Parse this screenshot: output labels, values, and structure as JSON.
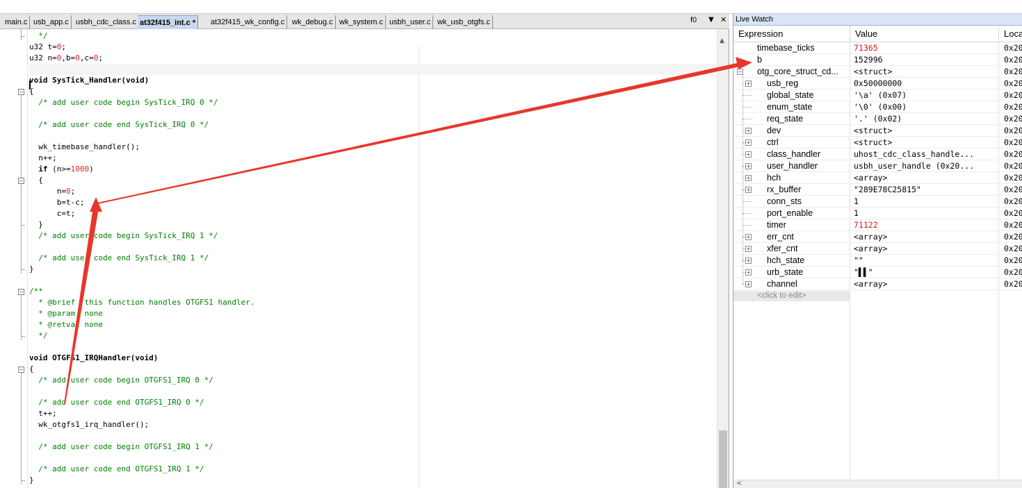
{
  "editor": {
    "tabs": [
      "main.c",
      "usb_app.c",
      "usbh_cdc_class.c",
      "at32f415_int.c *",
      "at32f415_wk_config.c",
      "wk_debug.c",
      "wk_system.c",
      "usbh_user.c",
      "wk_usb_otgfs.c"
    ],
    "active_tab": "at32f415_int.c *",
    "function_dropdown": "f0",
    "lines": [
      {
        "t": "  */",
        "c": "cm"
      },
      {
        "t": "u32 t=0;"
      },
      {
        "t": "u32 n=0,b=0,c=0;"
      },
      {
        "t": ""
      },
      {
        "t": "void SysTick_Handler(void)",
        "c": "kw"
      },
      {
        "t": "{"
      },
      {
        "t": "  /* add user code begin SysTick_IRQ 0 */",
        "c": "cm"
      },
      {
        "t": ""
      },
      {
        "t": "  /* add user code end SysTick_IRQ 0 */",
        "c": "cm"
      },
      {
        "t": ""
      },
      {
        "t": "  wk_timebase_handler();"
      },
      {
        "t": "  n++;"
      },
      {
        "t": "  if (n>=1000)"
      },
      {
        "t": "  {"
      },
      {
        "t": "      n=0;"
      },
      {
        "t": "      b=t-c;"
      },
      {
        "t": "      c=t;"
      },
      {
        "t": "  }"
      },
      {
        "t": "  /* add user code begin SysTick_IRQ 1 */",
        "c": "cm"
      },
      {
        "t": ""
      },
      {
        "t": "  /* add user code end SysTick_IRQ 1 */",
        "c": "cm"
      },
      {
        "t": "}"
      },
      {
        "t": ""
      },
      {
        "t": "/**",
        "c": "cm"
      },
      {
        "t": "  * @brief  this function handles OTGFS1 handler.",
        "c": "cm"
      },
      {
        "t": "  * @param  none",
        "c": "cm"
      },
      {
        "t": "  * @retval none",
        "c": "cm"
      },
      {
        "t": "  */",
        "c": "cm"
      },
      {
        "t": ""
      },
      {
        "t": "void OTGFS1_IRQHandler(void)",
        "c": "kw"
      },
      {
        "t": "{"
      },
      {
        "t": "  /* add user code begin OTGFS1_IRQ 0 */",
        "c": "cm"
      },
      {
        "t": ""
      },
      {
        "t": "  /* add user code end OTGFS1_IRQ 0 */",
        "c": "cm"
      },
      {
        "t": "  t++;"
      },
      {
        "t": "  wk_otgfs1_irq_handler();"
      },
      {
        "t": ""
      },
      {
        "t": "  /* add user code begin OTGFS1_IRQ 1 */",
        "c": "cm"
      },
      {
        "t": ""
      },
      {
        "t": "  /* add user code end OTGFS1_IRQ 1 */",
        "c": "cm"
      },
      {
        "t": "}"
      }
    ]
  },
  "watch": {
    "title": "Live Watch",
    "columns": [
      "Expression",
      "Value",
      "Location"
    ],
    "rows": [
      {
        "expr": "timebase_ticks",
        "value": "71365",
        "loc": "0x20",
        "red": true,
        "level": 0
      },
      {
        "expr": "b",
        "value": "152996",
        "loc": "0x20",
        "red": false,
        "level": 0
      },
      {
        "expr": "otg_core_struct_cd...",
        "value": "<struct>",
        "loc": "0x20",
        "red": false,
        "level": 0,
        "expander": "minus"
      },
      {
        "expr": "usb_reg",
        "value": "0x50000000",
        "loc": "0x20",
        "red": false,
        "level": 1,
        "expander": "plus"
      },
      {
        "expr": "global_state",
        "value": "'\\a' (0x07)",
        "loc": "0x20",
        "red": false,
        "level": 1
      },
      {
        "expr": "enum_state",
        "value": "'\\0' (0x00)",
        "loc": "0x20",
        "red": false,
        "level": 1
      },
      {
        "expr": "req_state",
        "value": "'.' (0x02)",
        "loc": "0x20",
        "red": false,
        "level": 1
      },
      {
        "expr": "dev",
        "value": "<struct>",
        "loc": "0x20",
        "red": false,
        "level": 1,
        "expander": "plus"
      },
      {
        "expr": "ctrl",
        "value": "<struct>",
        "loc": "0x20",
        "red": false,
        "level": 1,
        "expander": "plus"
      },
      {
        "expr": "class_handler",
        "value": "uhost_cdc_class_handle...",
        "loc": "0x20",
        "red": false,
        "level": 1,
        "expander": "plus"
      },
      {
        "expr": "user_handler",
        "value": "usbh_user_handle (0x20...",
        "loc": "0x20",
        "red": false,
        "level": 1,
        "expander": "plus"
      },
      {
        "expr": "hch",
        "value": "<array>",
        "loc": "0x20",
        "red": false,
        "level": 1,
        "expander": "plus"
      },
      {
        "expr": "rx_buffer",
        "value": "\"289E78C25815\"",
        "loc": "0x20",
        "red": false,
        "level": 1,
        "expander": "plus"
      },
      {
        "expr": "conn_sts",
        "value": "1",
        "loc": "0x20",
        "red": false,
        "level": 1
      },
      {
        "expr": "port_enable",
        "value": "1",
        "loc": "0x20",
        "red": false,
        "level": 1
      },
      {
        "expr": "timer",
        "value": "71122",
        "loc": "0x20",
        "red": true,
        "level": 1
      },
      {
        "expr": "err_cnt",
        "value": "<array>",
        "loc": "0x20",
        "red": false,
        "level": 1,
        "expander": "plus"
      },
      {
        "expr": "xfer_cnt",
        "value": "<array>",
        "loc": "0x20",
        "red": false,
        "level": 1,
        "expander": "plus"
      },
      {
        "expr": "hch_state",
        "value": "\"\"",
        "loc": "0x20",
        "red": false,
        "level": 1,
        "expander": "plus"
      },
      {
        "expr": "urb_state",
        "value": "\"▌▌\"",
        "loc": "0x20",
        "red": false,
        "level": 1,
        "expander": "plus"
      },
      {
        "expr": "channel",
        "value": "<array>",
        "loc": "0x20",
        "red": false,
        "level": 1,
        "expander": "plus"
      }
    ],
    "add_placeholder": "<click to edit>"
  },
  "colors": {
    "comment": "#008000",
    "number": "#e0242a",
    "changed_value": "#d9141b",
    "arrow": "#e8362c",
    "active_tab": "#c8d8ee"
  }
}
